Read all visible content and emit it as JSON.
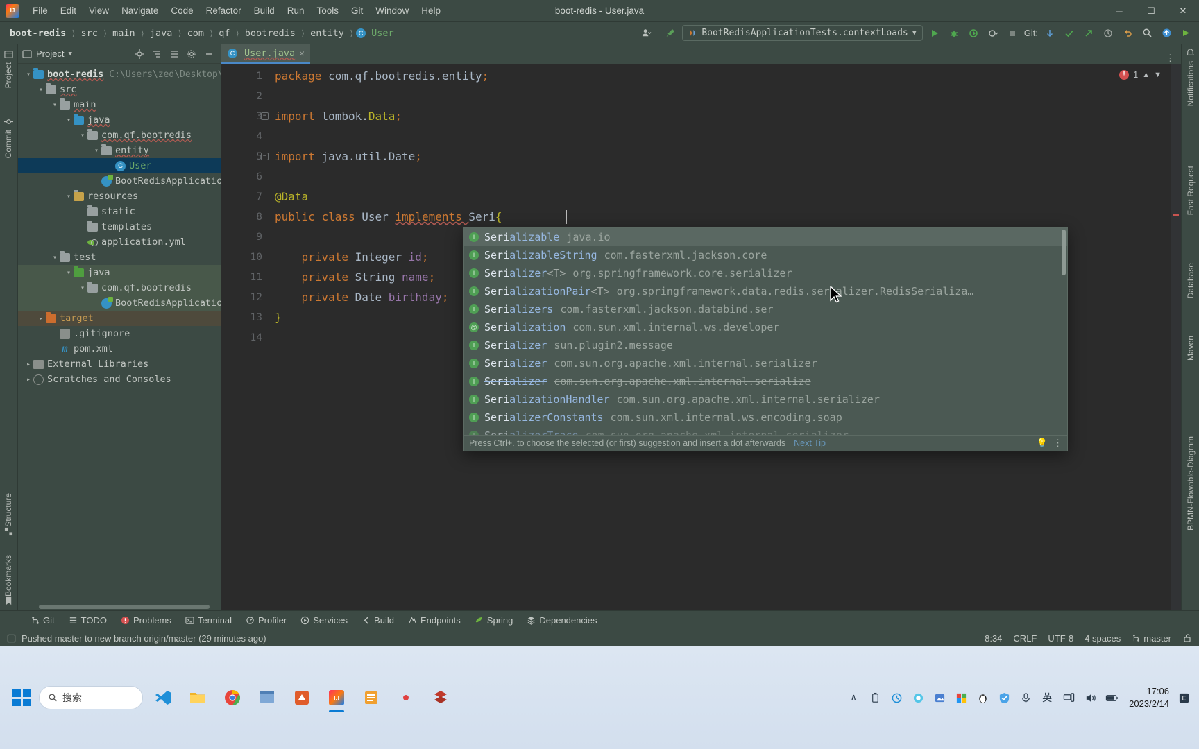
{
  "window": {
    "title": "boot-redis - User.java",
    "minimize": "─",
    "maximize": "☐",
    "close": "✕"
  },
  "menu": [
    "File",
    "Edit",
    "View",
    "Navigate",
    "Code",
    "Refactor",
    "Build",
    "Run",
    "Tools",
    "Git",
    "Window",
    "Help"
  ],
  "breadcrumbs": [
    {
      "label": "boot-redis",
      "style": "bold"
    },
    {
      "label": "src",
      "style": "normal"
    },
    {
      "label": "main",
      "style": "normal"
    },
    {
      "label": "java",
      "style": "normal"
    },
    {
      "label": "com",
      "style": "normal"
    },
    {
      "label": "qf",
      "style": "normal"
    },
    {
      "label": "bootredis",
      "style": "normal"
    },
    {
      "label": "entity",
      "style": "normal"
    },
    {
      "label": "User",
      "style": "class"
    }
  ],
  "toolbar": {
    "run_config": "BootRedisApplicationTests.contextLoads",
    "git_label": "Git:",
    "separator": "›"
  },
  "project_panel": {
    "title": "Project",
    "project_path": "C:\\Users\\zed\\Desktop\\",
    "tree": [
      {
        "depth": 0,
        "label": "boot-redis",
        "icon": "module-folder",
        "arrow": "down",
        "style": "bold",
        "path": "C:\\Users\\zed\\Desktop\\"
      },
      {
        "depth": 1,
        "label": "src",
        "icon": "folder",
        "arrow": "down"
      },
      {
        "depth": 2,
        "label": "main",
        "icon": "folder",
        "arrow": "down"
      },
      {
        "depth": 3,
        "label": "java",
        "icon": "folder-blue",
        "arrow": "down"
      },
      {
        "depth": 4,
        "label": "com.qf.bootredis",
        "icon": "package",
        "arrow": "down"
      },
      {
        "depth": 5,
        "label": "entity",
        "icon": "package",
        "arrow": "down"
      },
      {
        "depth": 6,
        "label": "User",
        "icon": "java-class",
        "arrow": "none",
        "selected": true,
        "style": "green"
      },
      {
        "depth": 5,
        "label": "BootRedisApplication",
        "icon": "spring-class",
        "arrow": "none"
      },
      {
        "depth": 3,
        "label": "resources",
        "icon": "folder-resources",
        "arrow": "down"
      },
      {
        "depth": 4,
        "label": "static",
        "icon": "folder",
        "arrow": "none"
      },
      {
        "depth": 4,
        "label": "templates",
        "icon": "folder",
        "arrow": "none"
      },
      {
        "depth": 4,
        "label": "application.yml",
        "icon": "yml",
        "arrow": "none"
      },
      {
        "depth": 2,
        "label": "test",
        "icon": "folder",
        "arrow": "down"
      },
      {
        "depth": 3,
        "label": "java",
        "icon": "folder-green",
        "arrow": "down",
        "highlight": "test"
      },
      {
        "depth": 4,
        "label": "com.qf.bootredis",
        "icon": "package",
        "arrow": "down",
        "highlight": "test"
      },
      {
        "depth": 5,
        "label": "BootRedisApplicationTests",
        "icon": "spring-class",
        "arrow": "none",
        "highlight": "test"
      },
      {
        "depth": 1,
        "label": "target",
        "icon": "folder-orange",
        "arrow": "right",
        "style": "orange",
        "highlight": "target"
      },
      {
        "depth": 1,
        "label": ".gitignore",
        "icon": "git",
        "arrow": "none"
      },
      {
        "depth": 1,
        "label": "pom.xml",
        "icon": "maven",
        "arrow": "none"
      },
      {
        "depth": 0,
        "label": "External Libraries",
        "icon": "library",
        "arrow": "right"
      },
      {
        "depth": 0,
        "label": "Scratches and Consoles",
        "icon": "scratch",
        "arrow": "right"
      }
    ]
  },
  "left_strip": [
    "Project",
    "Commit"
  ],
  "right_strip": [
    "Notifications",
    "Fast Request",
    "Database",
    "Maven",
    "BPMN-Flowable-Diagram"
  ],
  "left_bottom_strip": [
    "Structure",
    "Bookmarks"
  ],
  "editor": {
    "tab": {
      "label": "User.java",
      "close": "✕"
    },
    "error_count": "1",
    "lines": [
      {
        "n": 1,
        "tokens": [
          {
            "t": "package ",
            "c": "kw"
          },
          {
            "t": "com.qf.bootredis.entity",
            "c": "plain"
          },
          {
            "t": ";",
            "c": "semi"
          }
        ]
      },
      {
        "n": 2,
        "tokens": []
      },
      {
        "n": 3,
        "fold": "minus",
        "tokens": [
          {
            "t": "import ",
            "c": "kw"
          },
          {
            "t": "lombok.",
            "c": "plain"
          },
          {
            "t": "Data",
            "c": "anno"
          },
          {
            "t": ";",
            "c": "semi"
          }
        ]
      },
      {
        "n": 4,
        "tokens": []
      },
      {
        "n": 5,
        "fold": "square",
        "tokens": [
          {
            "t": "import ",
            "c": "kw"
          },
          {
            "t": "java.util.Date",
            "c": "plain"
          },
          {
            "t": ";",
            "c": "semi"
          }
        ]
      },
      {
        "n": 6,
        "tokens": []
      },
      {
        "n": 7,
        "tokens": [
          {
            "t": "@Data",
            "c": "anno"
          }
        ]
      },
      {
        "n": 8,
        "tokens": [
          {
            "t": "public ",
            "c": "kw"
          },
          {
            "t": "class ",
            "c": "kw"
          },
          {
            "t": "User ",
            "c": "plain"
          },
          {
            "t": "implements ",
            "c": "kw"
          },
          {
            "t": "Seri",
            "c": "plain"
          },
          {
            "t": "{",
            "c": "brace"
          }
        ]
      },
      {
        "n": 9,
        "tokens": []
      },
      {
        "n": 10,
        "tokens": [
          {
            "t": "    private ",
            "c": "kw"
          },
          {
            "t": "Integer ",
            "c": "plain"
          },
          {
            "t": "id",
            "c": "field"
          },
          {
            "t": ";",
            "c": "semi"
          }
        ]
      },
      {
        "n": 11,
        "tokens": [
          {
            "t": "    private ",
            "c": "kw"
          },
          {
            "t": "String ",
            "c": "plain"
          },
          {
            "t": "name",
            "c": "field"
          },
          {
            "t": ";",
            "c": "semi"
          }
        ]
      },
      {
        "n": 12,
        "tokens": [
          {
            "t": "    private ",
            "c": "kw"
          },
          {
            "t": "Date ",
            "c": "plain"
          },
          {
            "t": "birthday",
            "c": "field"
          },
          {
            "t": ";",
            "c": "semi"
          }
        ]
      },
      {
        "n": 13,
        "tokens": [
          {
            "t": "}",
            "c": "brace"
          }
        ]
      },
      {
        "n": 14,
        "tokens": []
      }
    ]
  },
  "autocomplete": {
    "items": [
      {
        "name": "Serializable",
        "prefix": "Seri",
        "generic": "",
        "pkg": "java.io",
        "icon": "I",
        "selected": true
      },
      {
        "name": "SerializableString",
        "prefix": "Seri",
        "generic": "",
        "pkg": "com.fasterxml.jackson.core",
        "icon": "I"
      },
      {
        "name": "Serializer",
        "prefix": "Seri",
        "generic": "<T>",
        "pkg": "org.springframework.core.serializer",
        "icon": "I"
      },
      {
        "name": "SerializationPair",
        "prefix": "Seri",
        "generic": "<T>",
        "pkg": "org.springframework.data.redis.serializer.RedisSerializa…",
        "icon": "I",
        "marked": true
      },
      {
        "name": "Serializers",
        "prefix": "Seri",
        "generic": "",
        "pkg": "com.fasterxml.jackson.databind.ser",
        "icon": "I"
      },
      {
        "name": "Serialization",
        "prefix": "Seri",
        "generic": "",
        "pkg": "com.sun.xml.internal.ws.developer",
        "icon": "@"
      },
      {
        "name": "Serializer",
        "prefix": "Seri",
        "generic": "",
        "pkg": "sun.plugin2.message",
        "icon": "I"
      },
      {
        "name": "Serializer",
        "prefix": "Seri",
        "generic": "",
        "pkg": "com.sun.org.apache.xml.internal.serializer",
        "icon": "I"
      },
      {
        "name": "Serializer",
        "prefix": "Seri",
        "generic": "",
        "pkg": "com.sun.org.apache.xml.internal.serialize",
        "icon": "I",
        "deprecated": true
      },
      {
        "name": "SerializationHandler",
        "prefix": "Seri",
        "generic": "",
        "pkg": "com.sun.org.apache.xml.internal.serializer",
        "icon": "I"
      },
      {
        "name": "SerializerConstants",
        "prefix": "Seri",
        "generic": "",
        "pkg": "com.sun.xml.internal.ws.encoding.soap",
        "icon": "I"
      },
      {
        "name": "SerializerTrace",
        "prefix": "Seri",
        "generic": "",
        "pkg": "com.sun.org.apache.xml.internal.serializer",
        "icon": "I"
      }
    ],
    "footer_tip": "Press Ctrl+. to choose the selected (or first) suggestion and insert a dot afterwards",
    "footer_next": "Next Tip"
  },
  "bottom_windows": [
    {
      "label": "Git",
      "icon": "branch-icon"
    },
    {
      "label": "TODO",
      "icon": "list-icon"
    },
    {
      "label": "Problems",
      "icon": "error-icon"
    },
    {
      "label": "Terminal",
      "icon": "terminal-icon"
    },
    {
      "label": "Profiler",
      "icon": "profiler-icon"
    },
    {
      "label": "Services",
      "icon": "services-icon"
    },
    {
      "label": "Build",
      "icon": "build-icon"
    },
    {
      "label": "Endpoints",
      "icon": "endpoints-icon"
    },
    {
      "label": "Spring",
      "icon": "spring-icon"
    },
    {
      "label": "Dependencies",
      "icon": "dependencies-icon"
    }
  ],
  "status_bar": {
    "message": "Pushed master to new branch origin/master (29 minutes ago)",
    "position": "8:34",
    "line_sep": "CRLF",
    "encoding": "UTF-8",
    "indent": "4 spaces",
    "branch": "master"
  },
  "taskbar": {
    "search_placeholder": "搜索",
    "ime": "英",
    "time": "17:06",
    "date": "2023/2/14",
    "chevron": "∧"
  }
}
